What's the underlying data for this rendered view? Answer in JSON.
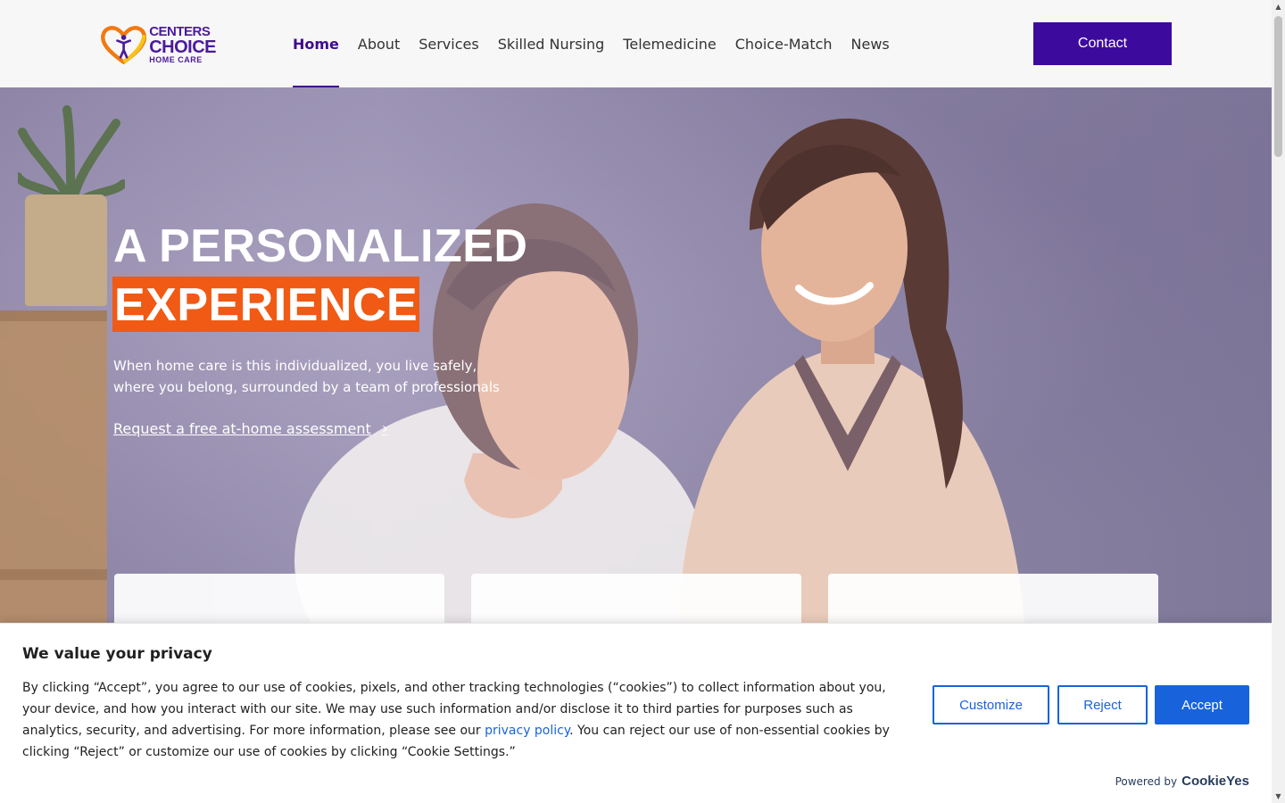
{
  "brand": {
    "line1": "CENTERS",
    "line2": "CHOICE",
    "line3": "HOME CARE"
  },
  "nav": {
    "items": [
      {
        "label": "Home",
        "active": true
      },
      {
        "label": "About",
        "active": false
      },
      {
        "label": "Services",
        "active": false
      },
      {
        "label": "Skilled Nursing",
        "active": false
      },
      {
        "label": "Telemedicine",
        "active": false
      },
      {
        "label": "Choice-Match",
        "active": false
      },
      {
        "label": "News",
        "active": false
      }
    ],
    "contact_label": "Contact"
  },
  "hero": {
    "title_line1": "A PERSONALIZED",
    "title_line2": "EXPERIENCE",
    "subtitle": "When home care is this individualized, you live safely, where you belong, surrounded by a team of professionals",
    "cta": "Request a free at-home assessment"
  },
  "cookie": {
    "title": "We value your privacy",
    "text_before": "By clicking “Accept”, you agree to our use of cookies, pixels, and other tracking technologies (“cookies”) to collect information about you, your device, and how you interact with our site. We may use such information and/or disclose it to third parties for purposes such as analytics, security, and advertising. For more information, please see our ",
    "link": "privacy policy",
    "text_after": ". You can reject our use of non-essential cookies by clicking “Reject” or customize our use of cookies by clicking “Cookie Settings.”",
    "customize": "Customize",
    "reject": "Reject",
    "accept": "Accept",
    "powered_by": "Powered by",
    "powered_brand": "CookieYes"
  },
  "colors": {
    "brand_purple": "#3d0a9e",
    "highlight_orange": "#f05a14",
    "cookie_blue": "#1863dc"
  }
}
